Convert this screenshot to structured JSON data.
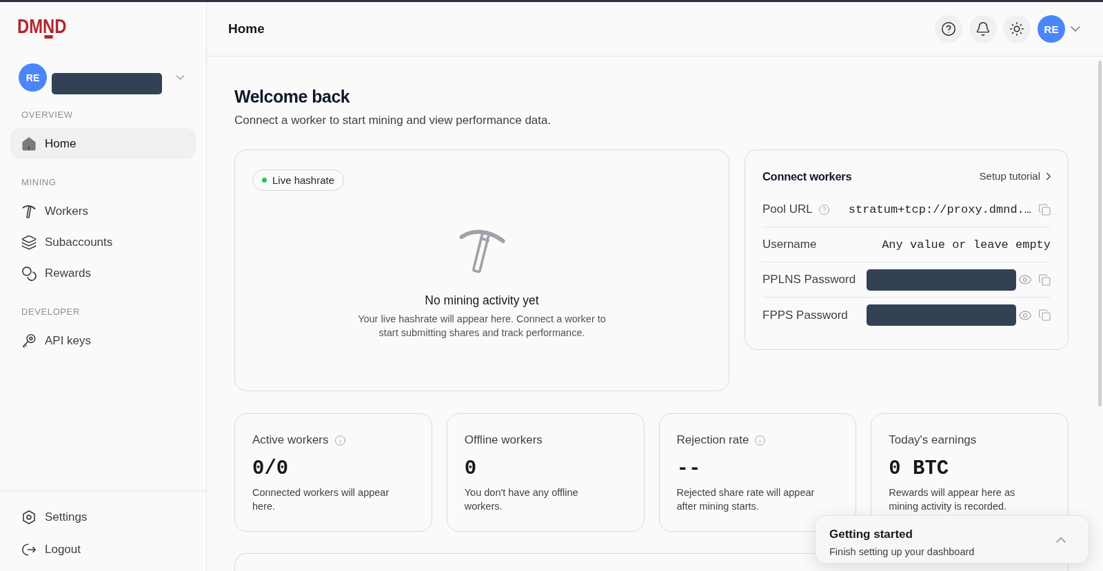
{
  "sidebar": {
    "logo": "DMND",
    "account": {
      "initials": "RE",
      "redacted": true
    },
    "sections": [
      {
        "heading": "OVERVIEW",
        "items": [
          {
            "label": "Home",
            "selected": true
          }
        ]
      },
      {
        "heading": "MINING",
        "items": [
          {
            "label": "Workers",
            "selected": false
          },
          {
            "label": "Subaccounts",
            "selected": false
          },
          {
            "label": "Rewards",
            "selected": false
          }
        ]
      },
      {
        "heading": "DEVELOPER",
        "items": [
          {
            "label": "API keys",
            "selected": false
          }
        ]
      }
    ],
    "footer_items": [
      {
        "label": "Settings"
      },
      {
        "label": "Logout"
      }
    ]
  },
  "header": {
    "title": "Home",
    "user_initials": "RE"
  },
  "welcome": {
    "title": "Welcome back",
    "subtitle": "Connect a worker to start mining and view performance data."
  },
  "hashrate_card": {
    "badge": {
      "label": "Live hashrate",
      "live": true
    },
    "empty_title": "No mining activity yet",
    "empty_text": "Your live hashrate will appear here. Connect a worker to start submitting shares and track performance."
  },
  "connect_card": {
    "title": "Connect workers",
    "link": "Setup tutorial",
    "fields": [
      {
        "label": "Pool URL",
        "kind": "text",
        "help": true,
        "value": "stratum+tcp://proxy.dmnd.…",
        "copyable": true
      },
      {
        "label": "Username",
        "kind": "text",
        "help": false,
        "value": "Any value or leave empty",
        "copyable": false
      },
      {
        "label": "PPLNS Password",
        "kind": "secret",
        "help": false,
        "redacted": true,
        "copyable": true
      },
      {
        "label": "FPPS Password",
        "kind": "secret",
        "help": false,
        "redacted": true,
        "copyable": true
      }
    ]
  },
  "stats": [
    {
      "label": "Active workers",
      "info": true,
      "value": "0/0",
      "note": "Connected workers will appear here."
    },
    {
      "label": "Offline workers",
      "info": false,
      "value": "0",
      "note": "You don't have any offline workers."
    },
    {
      "label": "Rejection rate",
      "info": true,
      "value": "--",
      "note": "Rejected share rate will appear after mining starts."
    },
    {
      "label": "Today's earnings",
      "info": false,
      "value": "0 BTC",
      "note": "Rewards will appear here as mining activity is recorded."
    }
  ],
  "getting_started": {
    "title": "Getting started",
    "subtitle": "Finish setting up your dashboard",
    "expanded": false
  }
}
